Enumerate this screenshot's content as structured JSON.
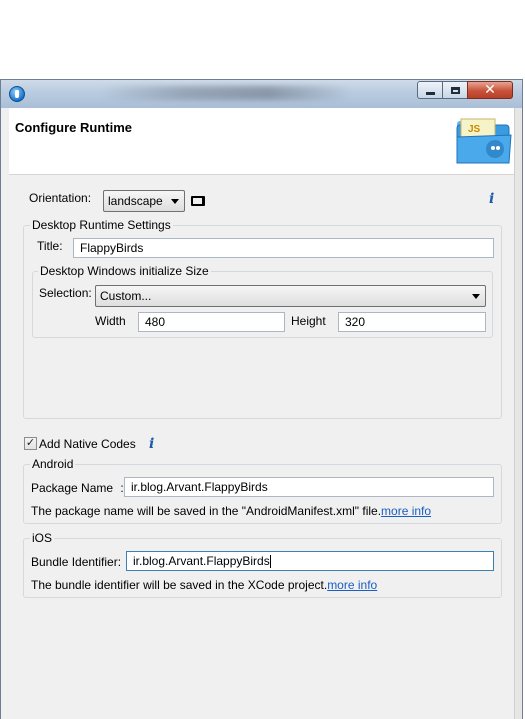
{
  "header": {
    "title": "Configure Runtime",
    "icon_text": "JS"
  },
  "orientation": {
    "label": "Orientation:",
    "value": "landscape"
  },
  "desktop": {
    "group_title": "Desktop Runtime Settings",
    "title_label": "Title:",
    "title_value": "FlappyBirds",
    "size_group_title": "Desktop Windows initialize Size",
    "selection_label": "Selection:",
    "selection_value": "Custom...",
    "width_label": "Width",
    "width_value": "480",
    "height_label": "Height",
    "height_value": "320"
  },
  "native": {
    "checkbox_label": "Add Native Codes",
    "checked": true
  },
  "android": {
    "group_title": "Android",
    "package_label": "Package Name",
    "package_separator": ":",
    "package_value": "ir.blog.Arvant.FlappyBirds",
    "note": "The package name will be saved in the \"AndroidManifest.xml\" file.",
    "link": "more info"
  },
  "ios": {
    "group_title": "iOS",
    "bundle_label": "Bundle Identifier:",
    "bundle_value": "ir.blog.Arvant.FlappyBirds",
    "note": "The bundle identifier will be saved in the XCode project.",
    "link": "more info"
  },
  "icons": {
    "info": "info-icon",
    "app": "app-icon",
    "screen": "screen-icon"
  },
  "colors": {
    "link": "#1a5ec2",
    "close_button": "#c7533a",
    "folder": "#3a9be0"
  }
}
